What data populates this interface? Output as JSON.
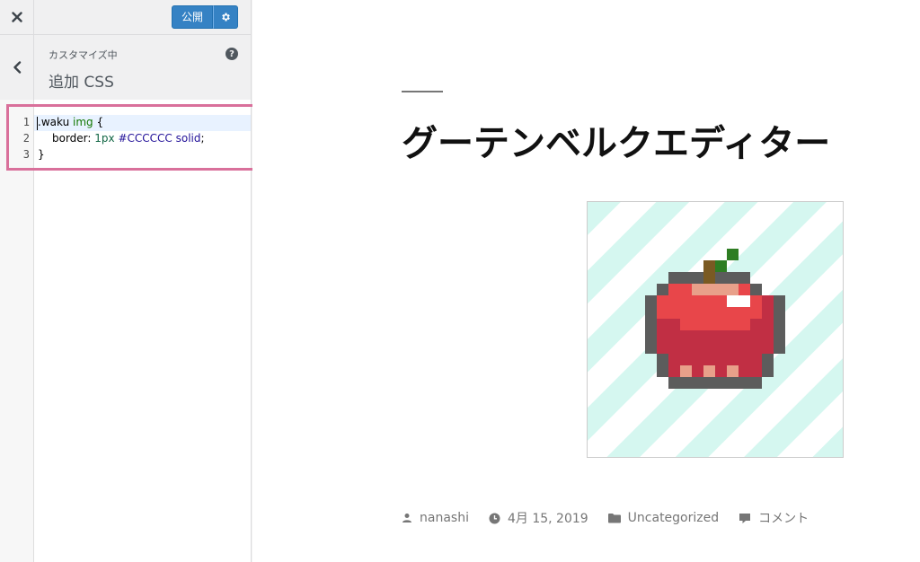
{
  "topbar": {
    "publish_label": "公開",
    "close_icon": "close-icon",
    "settings_icon": "gear-icon"
  },
  "section": {
    "subtitle": "カスタマイズ中",
    "title": "追加 CSS",
    "help_label": "?"
  },
  "editor": {
    "line_numbers": [
      "1",
      "2",
      "3"
    ],
    "lines": [
      {
        "selector": ".waku",
        "tag": "img",
        "brace": " {"
      },
      {
        "prop": "border: ",
        "num": "1px",
        "atom1": "#CCCCCC",
        "atom2": "solid",
        "end": ";"
      },
      {
        "text": "}"
      }
    ]
  },
  "preview": {
    "title": "グーテンベルクエディター",
    "meta": {
      "author": "nanashi",
      "date": "4月 15, 2019",
      "category": "Uncategorized",
      "comments": "コメント"
    }
  },
  "colors": {
    "accent": "#3582c4",
    "highlight": "#d9709b",
    "stripe": "#d5f7f0"
  }
}
